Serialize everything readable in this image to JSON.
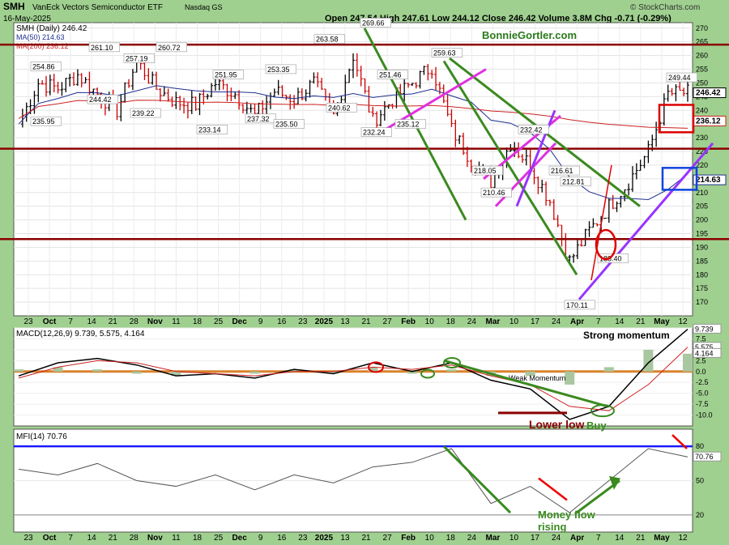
{
  "header": {
    "ticker": "SMH",
    "name": "VanEck Vectors Semiconductor ETF",
    "exchange": "Nasdaq GS",
    "date": "16-May-2025",
    "quote_text": "Open 247.54  High 247.61  Low 244.12  Close 246.42  Volume 3.8M  Chg -0.71 (-0.29%)",
    "watermark": "© StockCharts.com",
    "brand": "BonnieGortler.com"
  },
  "colors": {
    "bg": "#9fd08f",
    "panel": "#ffffff",
    "up": "#000000",
    "down": "#cc0000",
    "ma50": "#1f2f8f",
    "ma200": "#cc2222",
    "resistance": "#8b0000",
    "green_line": "#3a8a1f",
    "magenta": "#e030e0",
    "purple": "#9933ff",
    "highlight_red": "#dd0000",
    "highlight_blue": "#1144dd",
    "mfi_line": "#1a1aff",
    "macd_zero": "#d9822b"
  },
  "chart_data": [
    {
      "type": "candlestick",
      "title": "SMH (Daily) 246.42",
      "legend": [
        "MA(50) 214.63",
        "MA(200) 236.12"
      ],
      "ylim": [
        165,
        272
      ],
      "yticks": [
        170,
        175,
        180,
        185,
        190,
        195,
        200,
        205,
        210,
        215,
        220,
        225,
        230,
        235,
        240,
        245,
        250,
        255,
        260,
        265,
        270
      ],
      "series": [
        {
          "name": "SMH close (approx, weekly)",
          "x": [
            "Sep 23",
            "Sep 30",
            "Oct 7",
            "Oct 14",
            "Oct 21",
            "Oct 28",
            "Nov 4",
            "Nov 11",
            "Nov 18",
            "Nov 25",
            "Dec 2",
            "Dec 9",
            "Dec 16",
            "Dec 23",
            "Dec 30",
            "Jan 6",
            "Jan 13",
            "Jan 21",
            "Jan 27",
            "Feb 3",
            "Feb 10",
            "Feb 18",
            "Feb 24",
            "Mar 3",
            "Mar 10",
            "Mar 17",
            "Mar 24",
            "Mar 31",
            "Apr 7",
            "Apr 14",
            "Apr 21",
            "Apr 28",
            "May 5",
            "May 12",
            "May 16"
          ],
          "values": [
            235,
            250,
            248,
            253,
            246,
            240,
            258,
            248,
            243,
            242,
            250,
            246,
            238,
            247,
            244,
            250,
            238,
            260,
            236,
            244,
            250,
            256,
            233,
            222,
            214,
            228,
            220,
            207,
            185,
            196,
            205,
            214,
            225,
            246,
            246.42
          ]
        }
      ],
      "labels": [
        "254.86",
        "261.10",
        "244.42",
        "235.95",
        "257.19",
        "239.22",
        "260.72",
        "251.95",
        "233.14",
        "253.35",
        "237.32",
        "263.58",
        "235.50",
        "240.62",
        "269.66",
        "251.46",
        "232.24",
        "235.12",
        "259.63",
        "218.05",
        "210.46",
        "232.42",
        "216.61",
        "212.81",
        "170.11",
        "188.40",
        "249.44"
      ],
      "last_value": "246.42",
      "ma_values": {
        "ma50": "214.63",
        "ma200": "236.12"
      },
      "x_ticks": [
        "23",
        "Oct",
        "7",
        "14",
        "21",
        "28",
        "Nov",
        "11",
        "18",
        "25",
        "Dec",
        "9",
        "16",
        "23",
        "2025",
        "13",
        "21",
        "27",
        "Feb",
        "10",
        "18",
        "24",
        "Mar",
        "10",
        "17",
        "24",
        "Apr",
        "7",
        "14",
        "21",
        "May",
        "12"
      ]
    },
    {
      "type": "line",
      "title": "MACD(12,26,9) 9.739, 5.575, 4.164",
      "ylim": [
        -12.5,
        10
      ],
      "yticks": [
        10.0,
        7.5,
        5.0,
        2.5,
        0.0,
        -2.5,
        -5.0,
        -7.5,
        -10.0
      ],
      "last_values": [
        "9.739",
        "5.575",
        "4.164"
      ],
      "series": [
        {
          "name": "MACD",
          "x": [
            "Sep 23",
            "Oct 7",
            "Oct 21",
            "Nov 4",
            "Nov 18",
            "Dec 2",
            "Dec 16",
            "Dec 30",
            "Jan 13",
            "Jan 27",
            "Feb 10",
            "Feb 24",
            "Mar 10",
            "Mar 24",
            "Apr 7",
            "Apr 21",
            "May 5",
            "May 16"
          ],
          "values": [
            -1,
            2,
            3,
            1.5,
            -1,
            -0.5,
            -1.5,
            0.5,
            -0.5,
            2,
            0,
            2,
            -2,
            -4,
            -11,
            -8,
            2,
            9.7
          ]
        },
        {
          "name": "Signal",
          "x": [
            "Sep 23",
            "Oct 7",
            "Oct 21",
            "Nov 4",
            "Nov 18",
            "Dec 2",
            "Dec 16",
            "Dec 30",
            "Jan 13",
            "Jan 27",
            "Feb 10",
            "Feb 24",
            "Mar 10",
            "Mar 24",
            "Apr 7",
            "Apr 21",
            "May 5",
            "May 16"
          ],
          "values": [
            -1.5,
            1,
            2.5,
            2,
            0,
            -0.5,
            -1,
            0,
            0,
            1,
            0.5,
            1.5,
            -1,
            -3,
            -8,
            -9,
            -3,
            5.6
          ]
        }
      ],
      "annotations": [
        "Strong momentum",
        "Weak Momentum",
        "Lower low",
        "Buy"
      ]
    },
    {
      "type": "line",
      "title": "MFI(14) 70.76",
      "ylim": [
        5,
        95
      ],
      "yticks": [
        80,
        50,
        20
      ],
      "last_value": "70.76",
      "series": [
        {
          "name": "MFI",
          "x": [
            "Sep 23",
            "Oct 7",
            "Oct 21",
            "Nov 4",
            "Nov 18",
            "Dec 2",
            "Dec 16",
            "Dec 30",
            "Jan 13",
            "Jan 27",
            "Feb 10",
            "Feb 24",
            "Mar 10",
            "Mar 24",
            "Apr 7",
            "Apr 21",
            "May 5",
            "May 16"
          ],
          "values": [
            60,
            55,
            65,
            50,
            45,
            55,
            42,
            55,
            48,
            62,
            66,
            78,
            30,
            45,
            22,
            50,
            78,
            70.76
          ]
        }
      ],
      "annotations": [
        "Money flow rising"
      ]
    }
  ]
}
